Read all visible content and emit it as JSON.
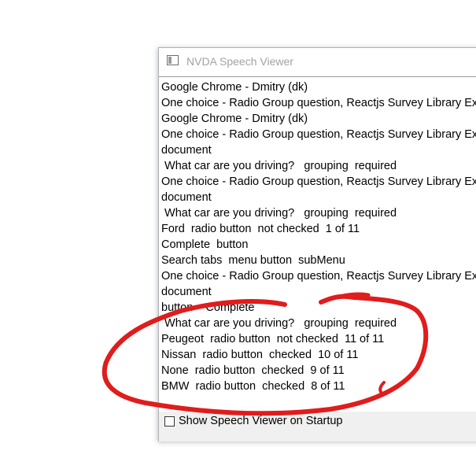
{
  "window": {
    "title": "NVDA Speech Viewer",
    "icon": "window-app-icon"
  },
  "speech_log": {
    "lines": [
      "Google Chrome - Dmitry (dk)",
      "One choice - Radio Group question, Reactjs Survey Library Ex",
      "Google Chrome - Dmitry (dk)",
      "One choice - Radio Group question, Reactjs Survey Library Ex",
      "document",
      " What car are you driving?   grouping  required",
      "One choice - Radio Group question, Reactjs Survey Library Ex",
      "document",
      " What car are you driving?   grouping  required",
      "Ford  radio button  not checked  1 of 11",
      "Complete  button",
      "Search tabs  menu button  subMenu",
      "One choice - Radio Group question, Reactjs Survey Library Ex",
      "document",
      "button    Complete",
      " What car are you driving?   grouping  required",
      "Peugeot  radio button  not checked  11 of 11",
      "Nissan  radio button  checked  10 of 11",
      "None  radio button  checked  9 of 11",
      "BMW  radio button  checked  8 of 11"
    ]
  },
  "footer": {
    "checkbox_label": "Show Speech Viewer on Startup",
    "checkbox_checked": false
  },
  "colors": {
    "annotation": "#e01c1c",
    "title_text": "#a2a2a2"
  }
}
